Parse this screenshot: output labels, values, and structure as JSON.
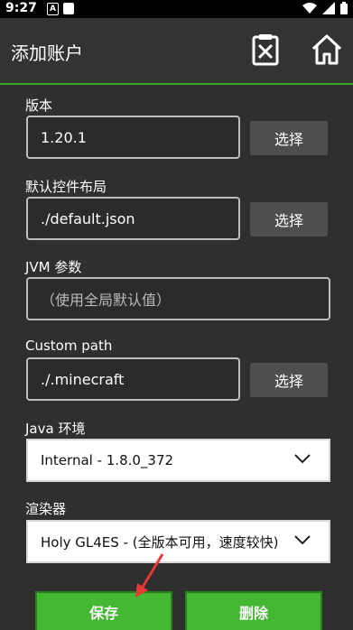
{
  "status": {
    "time": "9:27",
    "notif_icon": "A"
  },
  "appbar": {
    "title": "添加账户",
    "delete_icon": "clipboard-x-icon",
    "home_icon": "home-icon"
  },
  "form": {
    "version": {
      "label": "版本",
      "value": "1.20.1",
      "button": "选择"
    },
    "control_layout": {
      "label": "默认控件布局",
      "value": "./default.json",
      "button": "选择"
    },
    "jvm_args": {
      "label": "JVM 参数",
      "placeholder": "（使用全局默认值）"
    },
    "custom_path": {
      "label": "Custom path",
      "value": "./.minecraft",
      "button": "选择"
    },
    "java_env": {
      "label": "Java 环境",
      "selected": "Internal - 1.8.0_372"
    },
    "renderer": {
      "label": "渲染器",
      "selected": "Holy GL4ES - (全版本可用，速度较快)"
    }
  },
  "actions": {
    "save": "保存",
    "delete": "删除"
  },
  "colors": {
    "accent": "#44b832",
    "appbar": "#333333",
    "background": "#2f2f2f",
    "arrow": "#e53935"
  }
}
